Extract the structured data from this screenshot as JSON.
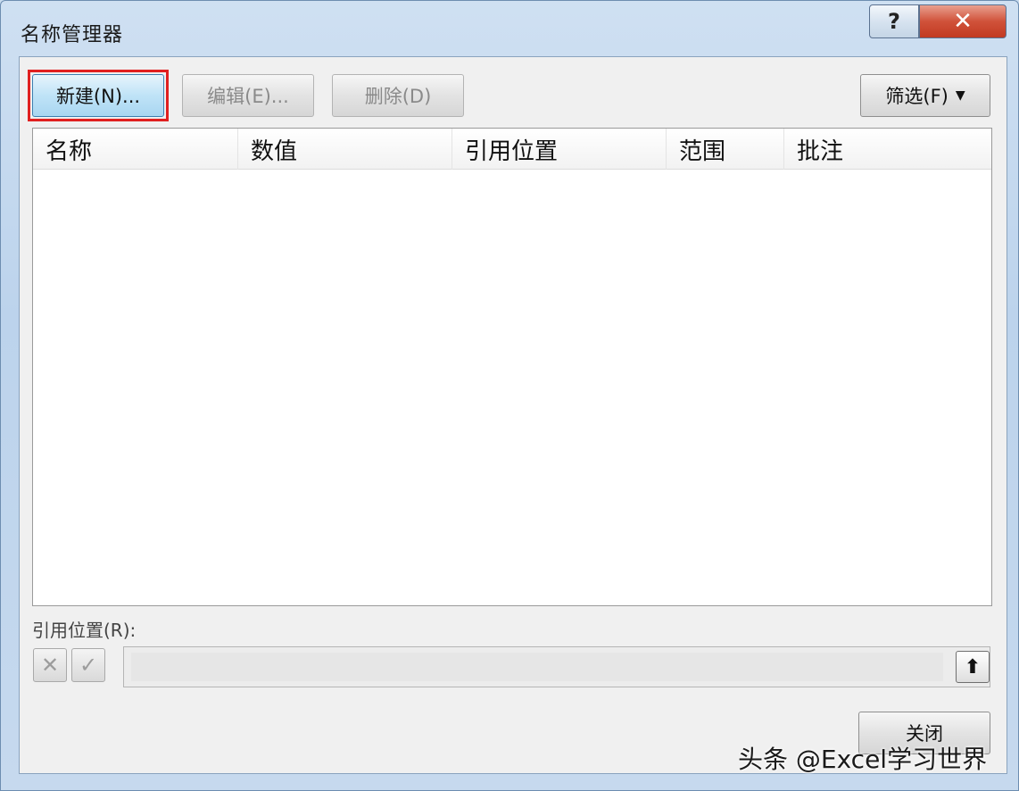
{
  "window": {
    "title": "名称管理器",
    "help_glyph": "?",
    "close_glyph": "✕"
  },
  "toolbar": {
    "new_label": "新建(N)...",
    "edit_label": "编辑(E)...",
    "delete_label": "删除(D)",
    "filter_label": "筛选(F)",
    "filter_caret": "▼"
  },
  "list": {
    "columns": [
      "名称",
      "数值",
      "引用位置",
      "范围",
      "批注"
    ],
    "rows": []
  },
  "reference": {
    "label": "引用位置(R):",
    "value": "",
    "cancel_glyph": "✕",
    "confirm_glyph": "✓",
    "collapse_glyph": "⬆"
  },
  "footer": {
    "close_label": "关闭"
  },
  "watermark": "头条 @Excel学习世界",
  "colors": {
    "highlight_border": "#e02020",
    "close_button": "#c23a22",
    "new_button": "#bfe3f7"
  }
}
